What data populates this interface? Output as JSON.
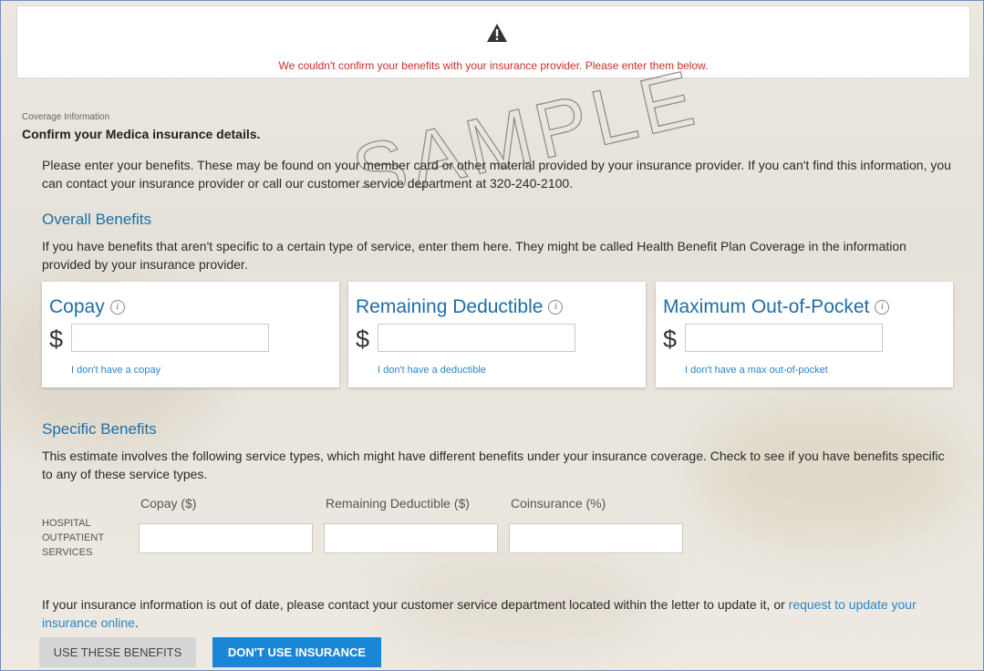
{
  "alert": {
    "icon": "warning-triangle-icon",
    "message": "We couldn't confirm your benefits with your insurance provider. Please enter them below."
  },
  "watermark": "SAMPLE",
  "coverage": {
    "section_label": "Coverage Information",
    "heading": "Confirm your Medica insurance details.",
    "intro": "Please enter your benefits. These may be found on your member card or other material provided by your insurance provider. If you can't find this information, you can contact your insurance provider or call our customer service department at 320-240-2100."
  },
  "overall": {
    "title": "Overall Benefits",
    "description": "If you have benefits that aren't specific to a certain type of service, enter them here. They might be called Health Benefit Plan Coverage in the information provided by your insurance provider.",
    "cards": [
      {
        "title": "Copay",
        "currency": "$",
        "value": "",
        "link": "I don't have a copay"
      },
      {
        "title": "Remaining Deductible",
        "currency": "$",
        "value": "",
        "link": "I don't have a deductible"
      },
      {
        "title": "Maximum Out-of-Pocket",
        "currency": "$",
        "value": "",
        "link": "I don't have a max out-of-pocket"
      }
    ],
    "info_glyph": "i"
  },
  "specific": {
    "title": "Specific Benefits",
    "description": "This estimate involves the following service types, which might have different benefits under your insurance coverage. Check to see if you have benefits specific to any of these service types.",
    "columns": [
      "Copay ($)",
      "Remaining Deductible ($)",
      "Coinsurance (%)"
    ],
    "rows": [
      {
        "label": "HOSPITAL OUTPATIENT SERVICES",
        "values": [
          "",
          "",
          ""
        ]
      }
    ]
  },
  "footer": {
    "note": "If your insurance information is out of date, please contact your customer service department located within the letter to update it, or ",
    "link_text": "request to update your insurance online",
    "note_end": "."
  },
  "buttons": {
    "use_benefits": "USE THESE BENEFITS",
    "no_insurance": "DON'T USE INSURANCE"
  },
  "colors": {
    "accent": "#1d6ea5",
    "link": "#2a86c8",
    "alert_text": "#c8302b",
    "primary_button": "#1a86d6"
  }
}
